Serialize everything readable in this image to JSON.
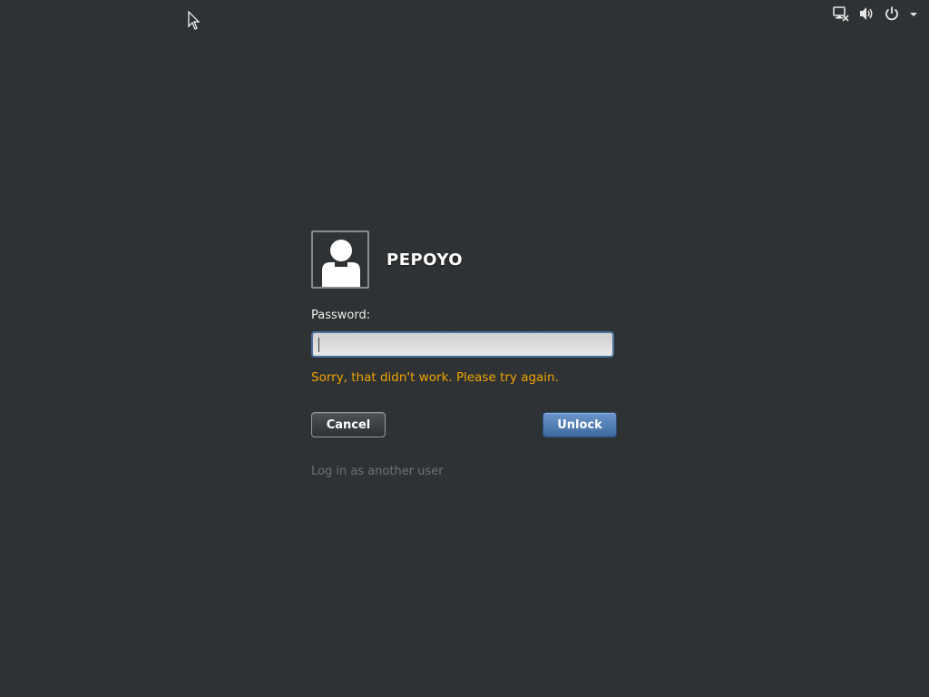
{
  "top_bar": {
    "icons": [
      {
        "name": "network-disconnected-icon"
      },
      {
        "name": "volume-icon"
      },
      {
        "name": "power-icon"
      },
      {
        "name": "dropdown-arrow-icon"
      }
    ]
  },
  "unlock_dialog": {
    "user_name": "PEPOYO",
    "avatar_icon": "user-avatar-icon",
    "password_label": "Password:",
    "password_value": "",
    "error_message": "Sorry, that didn't work. Please try again.",
    "cancel_label": "Cancel",
    "unlock_label": "Unlock",
    "other_user_link": "Log in as another user"
  },
  "colors": {
    "background": "#2f3234",
    "error": "#f0a500",
    "unlock_button": "#4f7cb3",
    "link": "#6f7274"
  }
}
